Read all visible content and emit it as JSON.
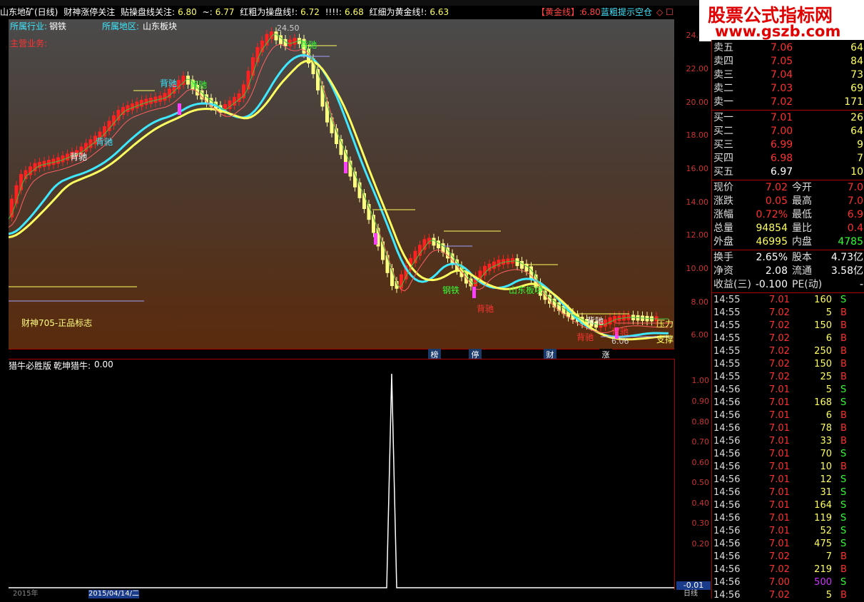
{
  "titlebar": {
    "stock": "山东地矿(日线)",
    "watch": "财神涨停关注",
    "t1": "贴操盘线关注:",
    "v1": "6.80",
    "t2": "~:",
    "v2": "6.77",
    "t3": "红粗为操盘线!:",
    "v3": "6.72",
    "t4": "!!!!:",
    "v4": "6.68",
    "t5": "红细为黄金线!:",
    "v5": "6.63",
    "gold": "【黄金线】:",
    "gold_val": "6.80",
    "blue": "蓝粗提示空仓",
    "icons": "◇ ☐"
  },
  "main": {
    "industry_label": "所属行业:",
    "industry": "钢铁",
    "region_label": "所属地区:",
    "region": "山东板块",
    "business_label": "主营业务:",
    "brand": "财神705-正品标志",
    "max_label": "24.50",
    "min_label": "6.06",
    "pressure": "压力",
    "support": "支撑",
    "tags": [
      "背驰",
      "背驰",
      "背驰",
      "背驰",
      "背驰",
      "背驰",
      "背驰",
      "背驰",
      "背驰"
    ],
    "steel": "钢铁",
    "region_tag": "山东板块",
    "price_ticks": [
      "24.00",
      "22.00",
      "20.00",
      "18.00",
      "16.00",
      "14.00",
      "12.00",
      "10.00",
      "8.00",
      "6.00"
    ],
    "price_range": [
      5.2,
      25.0
    ],
    "colors": {
      "up": "#ff2020",
      "down": "#ffff80",
      "fast": "#3ee8ff",
      "slow": "#ffff60"
    }
  },
  "signals": [
    "榜",
    "停",
    "财",
    "涨"
  ],
  "indicator": {
    "name": "猎牛必胜版",
    "series": "乾坤猎牛:",
    "value": "0.00",
    "ticks": [
      "1.00",
      "0.90",
      "0.80",
      "0.70",
      "0.60",
      "0.50",
      "0.40",
      "0.30",
      "0.20"
    ],
    "bottom": "-0.01"
  },
  "bottom": {
    "year": "2015年",
    "date": "2015/04/14/二",
    "period": "日线"
  },
  "logo": {
    "title": "股票公式指标网",
    "url": "www.gszb.com"
  },
  "orderbook": {
    "asks": [
      {
        "label": "卖五",
        "price": "7.06",
        "vol": "64"
      },
      {
        "label": "卖四",
        "price": "7.05",
        "vol": "84"
      },
      {
        "label": "卖三",
        "price": "7.04",
        "vol": "73"
      },
      {
        "label": "卖二",
        "price": "7.03",
        "vol": "69"
      },
      {
        "label": "卖一",
        "price": "7.02",
        "vol": "171"
      }
    ],
    "bids": [
      {
        "label": "买一",
        "price": "7.01",
        "vol": "26"
      },
      {
        "label": "买二",
        "price": "7.00",
        "vol": "64"
      },
      {
        "label": "买三",
        "price": "6.99",
        "vol": "9"
      },
      {
        "label": "买四",
        "price": "6.98",
        "vol": "7"
      },
      {
        "label": "买五",
        "price": "6.97",
        "vol": "10"
      }
    ]
  },
  "quote": [
    {
      "l1": "现价",
      "v1": "7.02",
      "l2": "今开",
      "v2": "7.0"
    },
    {
      "l1": "涨跌",
      "v1": "0.05",
      "l2": "最高",
      "v2": "7.0"
    },
    {
      "l1": "涨幅",
      "v1": "0.72%",
      "l2": "最低",
      "v2": "6.9"
    },
    {
      "l1": "总量",
      "v1": "94854",
      "l2": "量比",
      "v2": "0.4"
    },
    {
      "l1": "外盘",
      "v1": "46995",
      "l2": "内盘",
      "v2": "4785"
    }
  ],
  "stats": [
    {
      "l1": "换手",
      "v1": "2.65%",
      "l2": "股本",
      "v2": "4.73亿"
    },
    {
      "l1": "净资",
      "v1": "2.08",
      "l2": "流通",
      "v2": "3.58亿"
    },
    {
      "l1": "收益(三)",
      "v1": "-0.100",
      "l2": "PE(动)",
      "v2": "-"
    }
  ],
  "ticks": [
    [
      "14:55",
      "7.01",
      "160",
      "S"
    ],
    [
      "14:55",
      "7.02",
      "5",
      "B"
    ],
    [
      "14:55",
      "7.02",
      "150",
      "B"
    ],
    [
      "14:55",
      "7.02",
      "6",
      "B"
    ],
    [
      "14:55",
      "7.02",
      "250",
      "B"
    ],
    [
      "14:55",
      "7.02",
      "150",
      "B"
    ],
    [
      "14:55",
      "7.02",
      "25",
      "B"
    ],
    [
      "14:56",
      "7.01",
      "5",
      "S"
    ],
    [
      "14:56",
      "7.01",
      "168",
      "S"
    ],
    [
      "14:56",
      "7.01",
      "6",
      "B"
    ],
    [
      "14:56",
      "7.01",
      "78",
      "B"
    ],
    [
      "14:56",
      "7.01",
      "33",
      "B"
    ],
    [
      "14:56",
      "7.01",
      "70",
      "S"
    ],
    [
      "14:56",
      "7.01",
      "10",
      "B"
    ],
    [
      "14:56",
      "7.01",
      "12",
      "S"
    ],
    [
      "14:56",
      "7.01",
      "31",
      "S"
    ],
    [
      "14:56",
      "7.01",
      "164",
      "S"
    ],
    [
      "14:56",
      "7.01",
      "119",
      "S"
    ],
    [
      "14:56",
      "7.01",
      "52",
      "S"
    ],
    [
      "14:56",
      "7.01",
      "475",
      "S"
    ],
    [
      "14:56",
      "7.02",
      "7",
      "B"
    ],
    [
      "14:56",
      "7.02",
      "219",
      "B"
    ],
    [
      "14:56",
      "7.00",
      "500",
      "S"
    ],
    [
      "14:56",
      "7.02",
      "5",
      "B"
    ]
  ]
}
